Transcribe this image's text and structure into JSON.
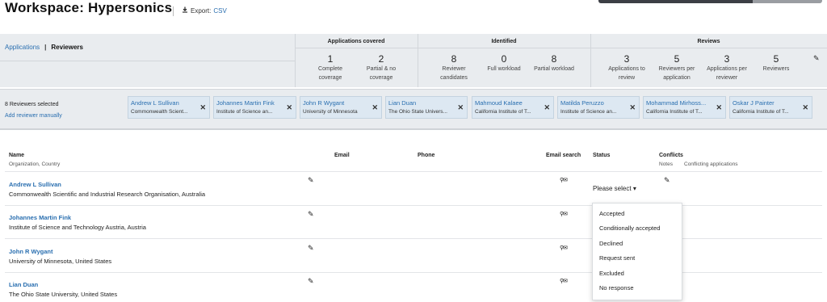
{
  "header": {
    "title": "Workspace: Hypersonics",
    "export_prefix": "Export:",
    "export_link": "CSV"
  },
  "tabs": {
    "applications": "Applications",
    "separator": "|",
    "reviewers": "Reviewers"
  },
  "summary": {
    "applications_covered": {
      "title": "Applications covered",
      "stats": [
        {
          "value": "1",
          "label1": "Complete",
          "label2": "coverage"
        },
        {
          "value": "2",
          "label1": "Partial & no",
          "label2": "coverage"
        }
      ]
    },
    "identified": {
      "title": "Identified",
      "stats": [
        {
          "value": "8",
          "label1": "Reviewer",
          "label2": "candidates"
        },
        {
          "value": "0",
          "label1": "Full workload",
          "label2": ""
        },
        {
          "value": "8",
          "label1": "Partial workload",
          "label2": ""
        }
      ]
    },
    "reviews": {
      "title": "Reviews",
      "stats": [
        {
          "value": "3",
          "label1": "Applications to",
          "label2": "review"
        },
        {
          "value": "5",
          "label1": "Reviewers per",
          "label2": "application"
        },
        {
          "value": "3",
          "label1": "Applications per",
          "label2": "reviewer"
        },
        {
          "value": "5",
          "label1": "Reviewers",
          "label2": ""
        }
      ]
    }
  },
  "selection": {
    "count_text": "8 Reviewers selected",
    "add_manual": "Add reviewer manually",
    "chips": [
      {
        "name": "Andrew L Sullivan",
        "org": "Commonwealth Scient..."
      },
      {
        "name": "Johannes Martin Fink",
        "org": "Institute of Science an..."
      },
      {
        "name": "John R Wygant",
        "org": "University of Minnesota"
      },
      {
        "name": "Lian Duan",
        "org": "The Ohio State Univers..."
      },
      {
        "name": "Mahmoud Kalaee",
        "org": "California Institute of T..."
      },
      {
        "name": "Matilda Peruzzo",
        "org": "Institute of Science an..."
      },
      {
        "name": "Mohammad Mirhoss...",
        "org": "California Institute of T..."
      },
      {
        "name": "Oskar J Painter",
        "org": "California Institute of T..."
      }
    ]
  },
  "table": {
    "headers": {
      "name": "Name",
      "name_sub": "Organization, Country",
      "email": "Email",
      "phone": "Phone",
      "email_search": "Email search",
      "status": "Status",
      "conflicts": "Conflicts",
      "conflicts_notes": "Notes",
      "conflicts_apps": "Conflicting applications"
    },
    "rows": [
      {
        "name": "Andrew L Sullivan",
        "org": "Commonwealth Scientific and Industrial Research Organisation, Australia"
      },
      {
        "name": "Johannes Martin Fink",
        "org": "Institute of Science and Technology Austria, Austria"
      },
      {
        "name": "John R Wygant",
        "org": "University of Minnesota, United States"
      },
      {
        "name": "Lian Duan",
        "org": "The Ohio State University, United States"
      }
    ],
    "status_placeholder": "Please select"
  },
  "status_options": [
    "Accepted",
    "Conditionally accepted",
    "Declined",
    "Request sent",
    "Excluded",
    "No response"
  ],
  "icons": {
    "export": "download-icon",
    "edit": "pencil-icon",
    "remove": "close-icon",
    "email_search": "search-mail-icon",
    "caret": "caret-down-icon"
  },
  "colors": {
    "link": "#2a6fb0",
    "panel_bg": "#e9ecef",
    "chip_bg": "#dde8f2"
  }
}
